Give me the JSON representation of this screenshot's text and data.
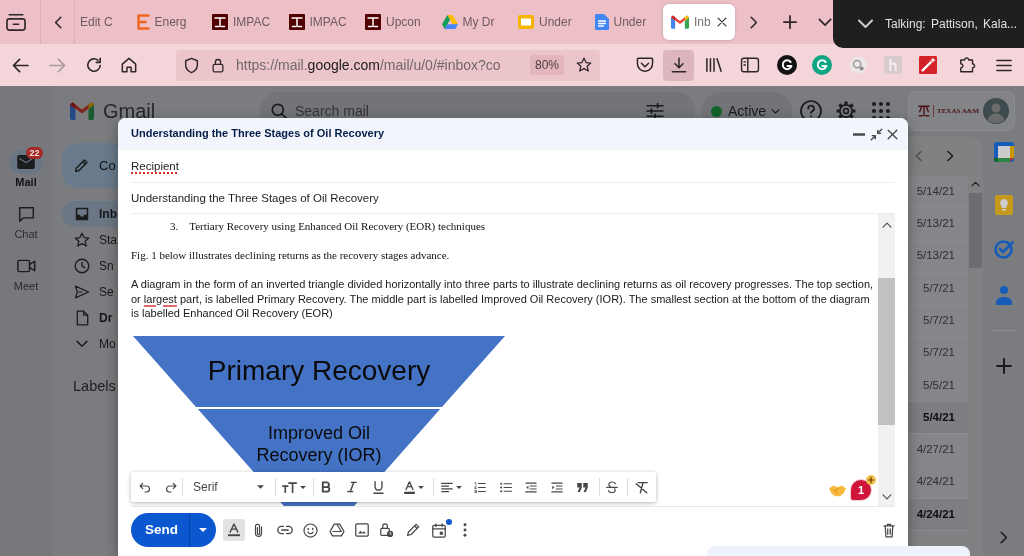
{
  "browser": {
    "tabs": [
      {
        "label": "Edit C",
        "kind": "plain",
        "selected": false
      },
      {
        "label": "Energ",
        "kind": "letter",
        "selected": false
      },
      {
        "label": "IMPAC",
        "kind": "emblem",
        "selected": false
      },
      {
        "label": "IMPAC",
        "kind": "emblem",
        "selected": false
      },
      {
        "label": "Upcon",
        "kind": "emblem",
        "selected": false
      },
      {
        "label": "My Dr",
        "kind": "drive",
        "selected": false
      },
      {
        "label": "Under",
        "kind": "slides",
        "selected": false
      },
      {
        "label": "Under",
        "kind": "docs",
        "selected": false
      },
      {
        "label": "Inb",
        "kind": "mail",
        "selected": true
      }
    ],
    "forward_disabled": true,
    "url": {
      "prefix": "https://mail.",
      "domain": "google.com",
      "path": "/mail/u/0/#inbox?co"
    },
    "zoom": "80%",
    "downloads_active": true
  },
  "call_banner": {
    "text": "Talking: Pattison, Kala..."
  },
  "gmail": {
    "brand": "Gmail",
    "rail": [
      {
        "label": "Mail",
        "kind": "mail",
        "badge": "22",
        "selected": true
      },
      {
        "label": "Chat",
        "kind": "chat",
        "selected": false
      },
      {
        "label": "Meet",
        "kind": "meet",
        "selected": false
      }
    ],
    "search": {
      "placeholder": "Search mail"
    },
    "status": {
      "label": "Active"
    },
    "account": {
      "org": "TEXAS A&M"
    },
    "compose_button": "Co",
    "folders": [
      {
        "label": "Inb",
        "kind": "inbox",
        "selected": true,
        "bold": true
      },
      {
        "label": "Sta",
        "kind": "starred",
        "selected": false,
        "bold": false
      },
      {
        "label": "Sn",
        "kind": "snoozed",
        "selected": false,
        "bold": false
      },
      {
        "label": "Se",
        "kind": "sent",
        "selected": false,
        "bold": false
      },
      {
        "label": "Dr",
        "kind": "drafts",
        "selected": false,
        "bold": true
      },
      {
        "label": "Mo",
        "kind": "more",
        "selected": false,
        "bold": false
      }
    ],
    "labels_heading": "Labels",
    "dates": [
      {
        "text": "5/14/21",
        "bold": false
      },
      {
        "text": "5/13/21",
        "bold": false
      },
      {
        "text": "5/13/21",
        "bold": false
      },
      {
        "text": "5/7/21",
        "bold": false
      },
      {
        "text": "5/7/21",
        "bold": false
      },
      {
        "text": "5/7/21",
        "bold": false
      },
      {
        "text": "5/5/21",
        "bold": false
      },
      {
        "text": "5/4/21",
        "bold": true
      },
      {
        "text": "4/27/21",
        "bold": false
      },
      {
        "text": "4/24/21",
        "bold": false
      },
      {
        "text": "4/24/21",
        "bold": true
      }
    ]
  },
  "compose": {
    "title": "Understanding the Three Stages of Oil Recovery",
    "recipient": {
      "value": "Recipient",
      "misspelled": true
    },
    "subject": {
      "value": "Understanding the Three Stages of Oil Recovery"
    },
    "body": {
      "list_item": {
        "number": "3.",
        "text": "Tertiary Recovery using Enhanced Oil Recovery (EOR) techniques"
      },
      "caption": "Fig. 1 below illustrates declining returns as the recovery stages advance.",
      "description": [
        {
          "text": "A diagram in the form of an inverted triangle divided horizontally into three parts to illustrate declining returns as oil recovery progresses. The top section, or ",
          "misspelled": false
        },
        {
          "text": "largest",
          "misspelled": true
        },
        {
          "text": " part, is labelled Primary Recovery. The middle part is labelled Improved Oil Recovery (IOR). The smallest section at the bottom of the diagram is labelled Enhanced Oil Recovery (EOR)",
          "misspelled": false
        }
      ],
      "diagram": {
        "sections": [
          {
            "label": "Primary Recovery"
          },
          {
            "label": "Improved Oil Recovery (IOR)"
          }
        ]
      }
    },
    "formatting_open": true,
    "toolbar": {
      "font": "Serif"
    },
    "send": "Send",
    "extension_count": "1"
  }
}
